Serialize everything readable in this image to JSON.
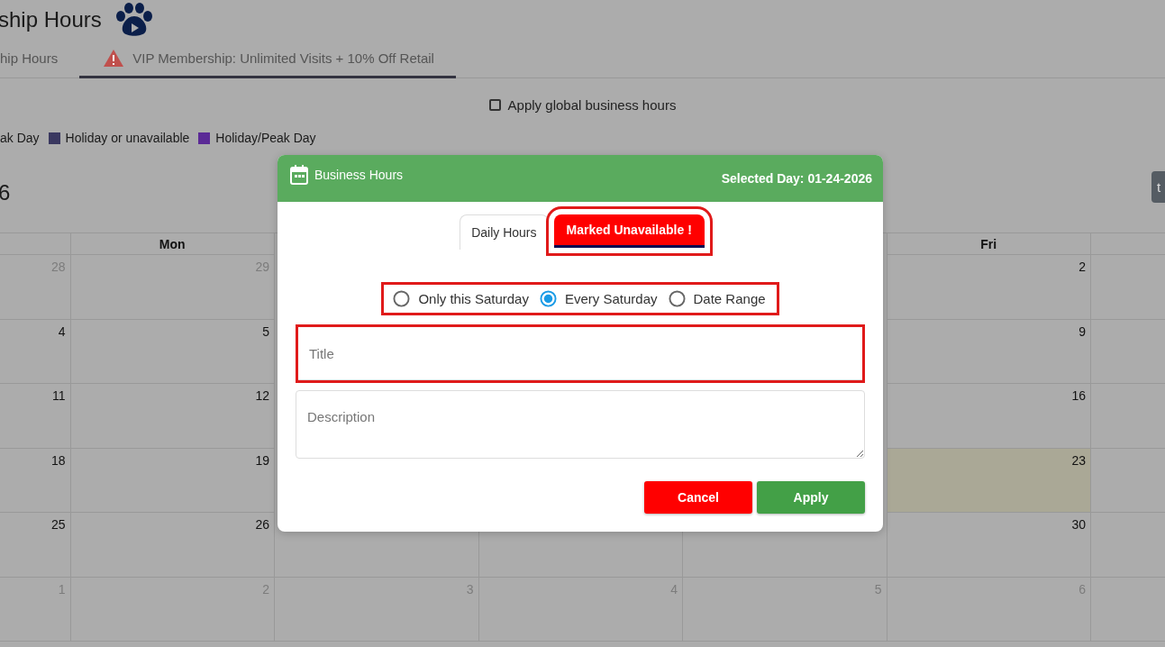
{
  "page_title": "ship Hours",
  "tabs": [
    {
      "label": "hip Hours",
      "selected": false,
      "warning": false
    },
    {
      "label": "VIP Membership: Unlimited Visits + 10% Off Retail",
      "selected": true,
      "warning": true
    }
  ],
  "global_hours": {
    "label": "Apply global business hours",
    "checked": false
  },
  "legend": [
    {
      "label": "ak Day"
    },
    {
      "label": "Holiday or unavailable",
      "color": "#3a3860"
    },
    {
      "label": "Holiday/Peak Day",
      "color": "#5b2a96"
    }
  ],
  "calendar": {
    "title": "6",
    "today_button": "t",
    "columns": [
      {
        "days": [
          {
            "day": "28",
            "muted": true,
            "today": false
          },
          {
            "day": "4",
            "muted": false,
            "today": false
          },
          {
            "day": "11",
            "muted": false,
            "today": false
          },
          {
            "day": "18",
            "muted": false,
            "today": false
          },
          {
            "day": "25",
            "muted": false,
            "today": false
          },
          {
            "day": "1",
            "muted": true,
            "today": false
          }
        ]
      },
      {
        "header": "Mon",
        "days": [
          {
            "day": "29",
            "muted": true,
            "today": false
          },
          {
            "day": "5",
            "muted": false,
            "today": false
          },
          {
            "day": "12",
            "muted": false,
            "today": false
          },
          {
            "day": "19",
            "muted": false,
            "today": false
          },
          {
            "day": "26",
            "muted": false,
            "today": false
          },
          {
            "day": "2",
            "muted": true,
            "today": false
          }
        ]
      },
      {
        "days": [
          {
            "day": "3",
            "muted": true,
            "today": false
          }
        ]
      },
      {
        "days": [
          {
            "day": "4",
            "muted": true,
            "today": false
          }
        ]
      },
      {
        "days": [
          {
            "day": "5",
            "muted": true,
            "today": false
          }
        ]
      },
      {
        "header": "Fri",
        "days": [
          {
            "day": "2",
            "muted": false,
            "today": false
          },
          {
            "day": "9",
            "muted": false,
            "today": false
          },
          {
            "day": "16",
            "muted": false,
            "today": false
          },
          {
            "day": "23",
            "muted": false,
            "today": true
          },
          {
            "day": "30",
            "muted": false,
            "today": false
          },
          {
            "day": "6",
            "muted": true,
            "today": false
          }
        ]
      }
    ]
  },
  "dialog": {
    "title": "Business Hours",
    "selected_day": "Selected Day: 01-24-2026",
    "tabs": [
      {
        "label": "Daily Hours",
        "selected": false,
        "highlighted": false
      },
      {
        "label": "Marked Unavailable !",
        "selected": true,
        "highlighted": true
      }
    ],
    "repeat_options": {
      "highlighted": true,
      "options": [
        {
          "label": "Only this Saturday",
          "selected": false
        },
        {
          "label": "Every Saturday",
          "selected": true
        },
        {
          "label": "Date Range",
          "selected": false
        }
      ]
    },
    "title_field": {
      "placeholder": "Title",
      "highlighted": true
    },
    "description_field": {
      "placeholder": "Description"
    },
    "buttons": [
      {
        "label": "Cancel",
        "kind": "danger"
      },
      {
        "label": "Apply",
        "kind": "primary"
      }
    ]
  }
}
